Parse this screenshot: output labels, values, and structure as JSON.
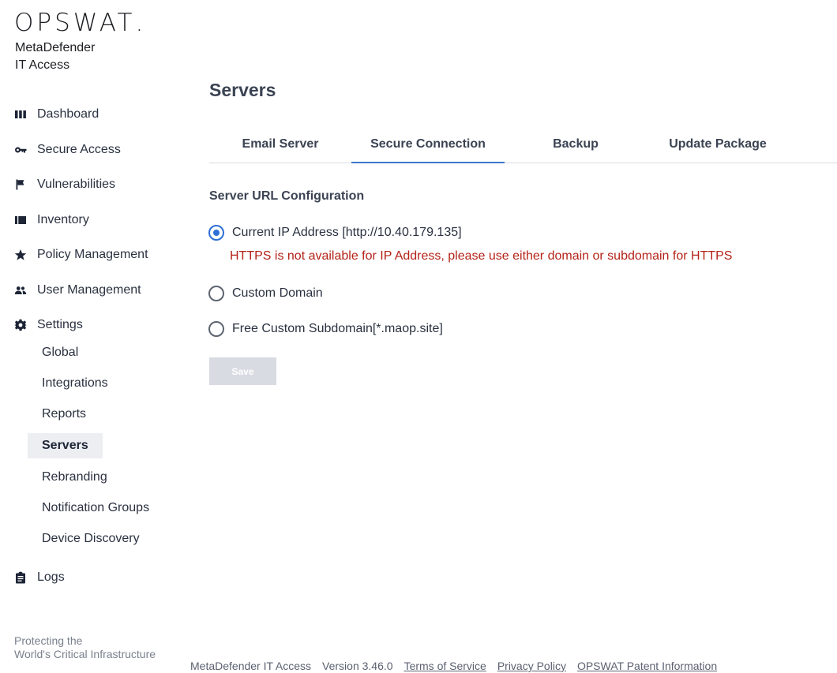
{
  "brand": {
    "logo_text": "OPSWAT",
    "logo_dot": ".",
    "product_line1": "MetaDefender",
    "product_line2": "IT Access"
  },
  "sidebar": {
    "items": [
      {
        "label": "Dashboard",
        "icon": "dashboard-icon"
      },
      {
        "label": "Secure Access",
        "icon": "key-icon"
      },
      {
        "label": "Vulnerabilities",
        "icon": "flag-icon"
      },
      {
        "label": "Inventory",
        "icon": "inventory-icon"
      },
      {
        "label": "Policy Management",
        "icon": "star-icon"
      },
      {
        "label": "User Management",
        "icon": "users-icon"
      },
      {
        "label": "Settings",
        "icon": "gear-icon"
      },
      {
        "label": "Logs",
        "icon": "clipboard-icon"
      }
    ],
    "settings_subitems": [
      {
        "label": "Global"
      },
      {
        "label": "Integrations"
      },
      {
        "label": "Reports"
      },
      {
        "label": "Servers",
        "active": true
      },
      {
        "label": "Rebranding"
      },
      {
        "label": "Notification Groups"
      },
      {
        "label": "Device Discovery"
      }
    ],
    "tagline_line1": "Protecting the",
    "tagline_line2": "World's Critical Infrastructure"
  },
  "main": {
    "title": "Servers",
    "tabs": [
      {
        "label": "Email Server"
      },
      {
        "label": "Secure Connection",
        "active": true
      },
      {
        "label": "Backup"
      },
      {
        "label": "Update Package"
      }
    ],
    "section_title": "Server URL Configuration",
    "options": [
      {
        "label": "Current IP Address [http://10.40.179.135]",
        "checked": true
      },
      {
        "label": "Custom Domain",
        "checked": false
      },
      {
        "label": "Free Custom Subdomain[*.maop.site]",
        "checked": false
      }
    ],
    "warning": "HTTPS is not available for IP Address, please use either domain or subdomain for HTTPS",
    "save_label": "Save"
  },
  "footer": {
    "product": "MetaDefender IT Access",
    "version": "Version 3.46.0",
    "terms": "Terms of Service",
    "privacy": "Privacy Policy",
    "patent": "OPSWAT Patent Information"
  },
  "colors": {
    "accent": "#2f6fd6",
    "tab_underline": "#3a78c7",
    "warning": "#b42318",
    "disabled_button": "#d8dbe2",
    "active_nav_bg": "#eceef2"
  }
}
